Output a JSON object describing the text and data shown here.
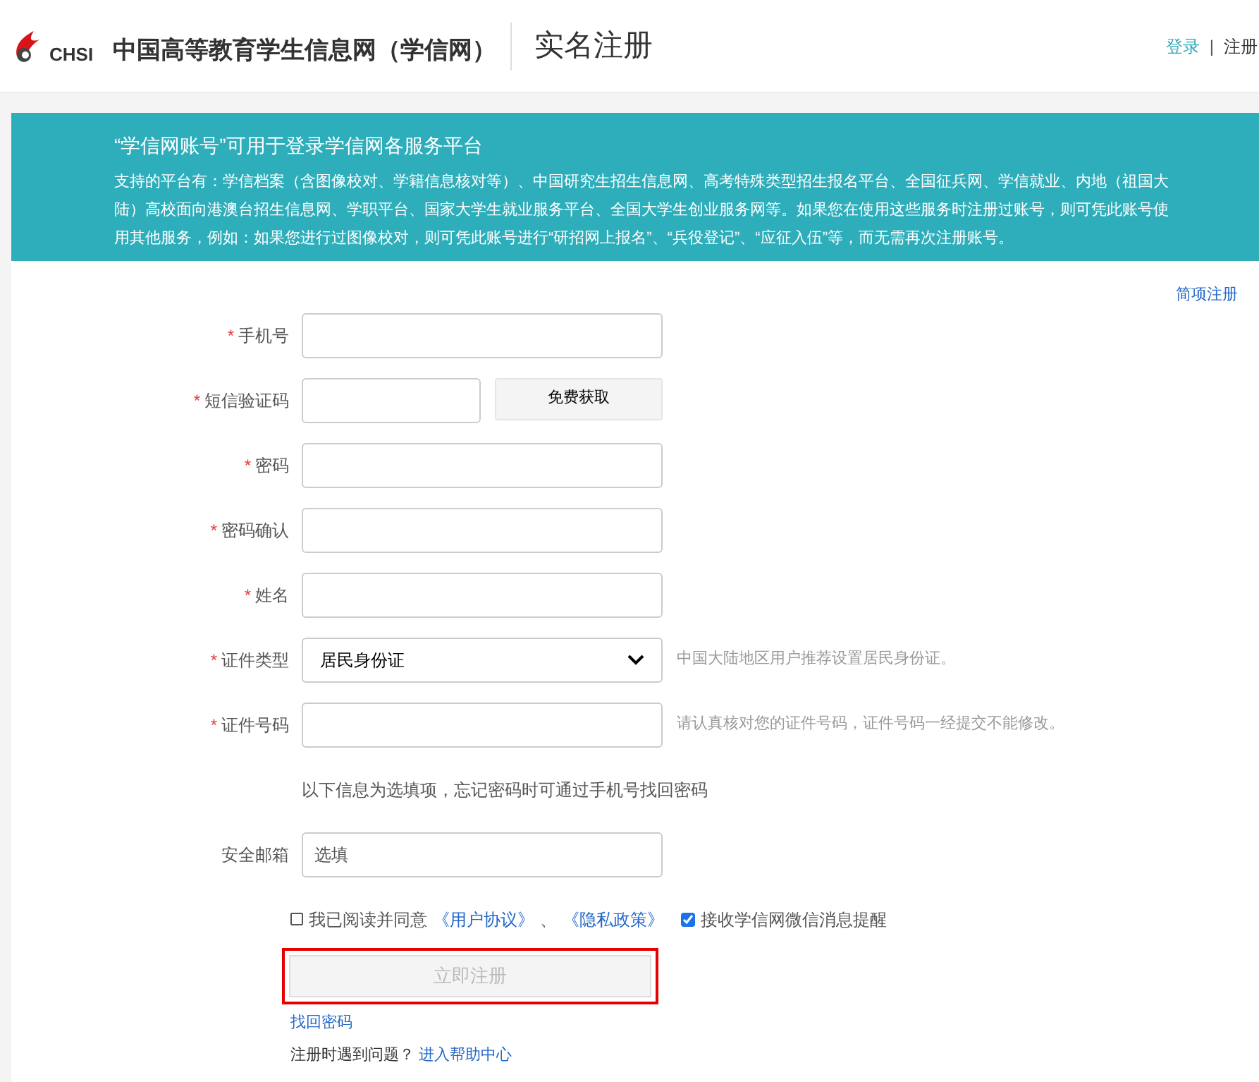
{
  "header": {
    "logo_text": "CHSI",
    "site_name": "中国高等教育学生信息网（学信网）",
    "page_title": "实名注册",
    "links": [
      {
        "label": "登录",
        "selected": true
      },
      {
        "label": "注册",
        "selected": false
      }
    ],
    "separator": "|"
  },
  "banner": {
    "title": "“学信网账号”可用于登录学信网各服务平台",
    "text": "支持的平台有：学信档案（含图像校对、学籍信息核对等）、中国研究生招生信息网、高考特殊类型招生报名平台、全国征兵网、学信就业、内地（祖国大陆）高校面向港澳台招生信息网、学职平台、国家大学生就业服务平台、全国大学生创业服务网等。如果您在使用这些服务时注册过账号，则可凭此账号使用其他服务，例如：如果您进行过图像校对，则可凭此账号进行“研招网上报名”、“兵役登记”、“应征入伍”等，而无需再次注册账号。"
  },
  "simple_register_link": "简项注册",
  "fields": [
    {
      "kind": "input",
      "label": "手机号",
      "required_mark": "*"
    },
    {
      "kind": "sms",
      "label": "短信验证码",
      "required_mark": "*",
      "button": "免费获取"
    },
    {
      "kind": "input",
      "label": "密码",
      "required_mark": "*"
    },
    {
      "kind": "input",
      "label": "密码确认",
      "required_mark": "*"
    },
    {
      "kind": "input",
      "label": "姓名",
      "required_mark": "*"
    },
    {
      "kind": "select",
      "label": "证件类型",
      "required_mark": "*",
      "value": "居民身份证",
      "hint": "中国大陆地区用户推荐设置居民身份证。"
    },
    {
      "kind": "input",
      "label": "证件号码",
      "required_mark": "*",
      "hint": "请认真核对您的证件号码，证件号码一经提交不能修改。"
    },
    {
      "kind": "note",
      "text": "以下信息为选填项，忘记密码时可通过手机号找回密码"
    },
    {
      "kind": "input",
      "label": "安全邮箱",
      "placeholder": "选填"
    }
  ],
  "agreement": {
    "checked": false,
    "text": "我已阅读并同意",
    "links": [
      "《用户协议》",
      "《隐私政策》"
    ],
    "joiner": "、"
  },
  "wechat_notice": {
    "checked": true,
    "text": "接收学信网微信消息提醒"
  },
  "submit": {
    "label": "立即注册",
    "disabled": true,
    "highlighted": true
  },
  "forgot_link": "找回密码",
  "help": {
    "text": "注册时遇到问题？",
    "link": "进入帮助中心"
  }
}
